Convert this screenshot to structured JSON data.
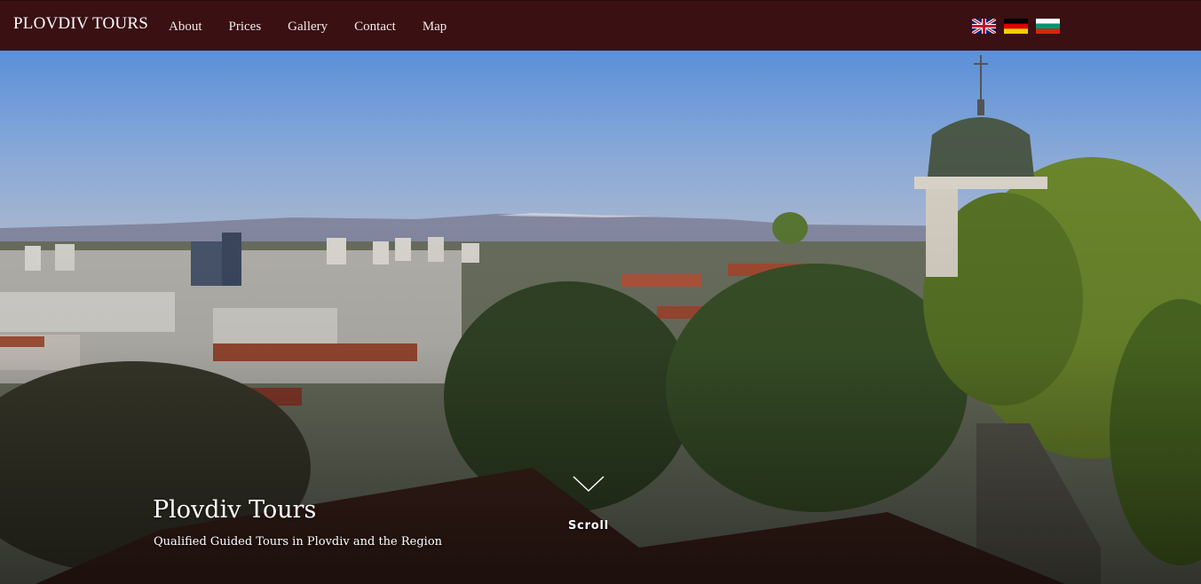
{
  "header": {
    "brand": "PLOVDIV TOURS",
    "nav": [
      "About",
      "Prices",
      "Gallery",
      "Contact",
      "Map"
    ]
  },
  "languages": [
    {
      "code": "en",
      "icon": "uk-flag-icon"
    },
    {
      "code": "de",
      "icon": "german-flag-icon"
    },
    {
      "code": "bg",
      "icon": "bulgarian-flag-icon"
    }
  ],
  "hero": {
    "title": "Plovdiv Tours",
    "subtitle": "Qualified Guided Tours in Plovdiv and the Region",
    "scroll_label": "Scroll",
    "scroll_icon": "chevron-down-icon",
    "background": "panorama-of-plovdiv-photo"
  },
  "colors": {
    "navbar_bg": "#3a1012",
    "text": "#ffffff"
  }
}
